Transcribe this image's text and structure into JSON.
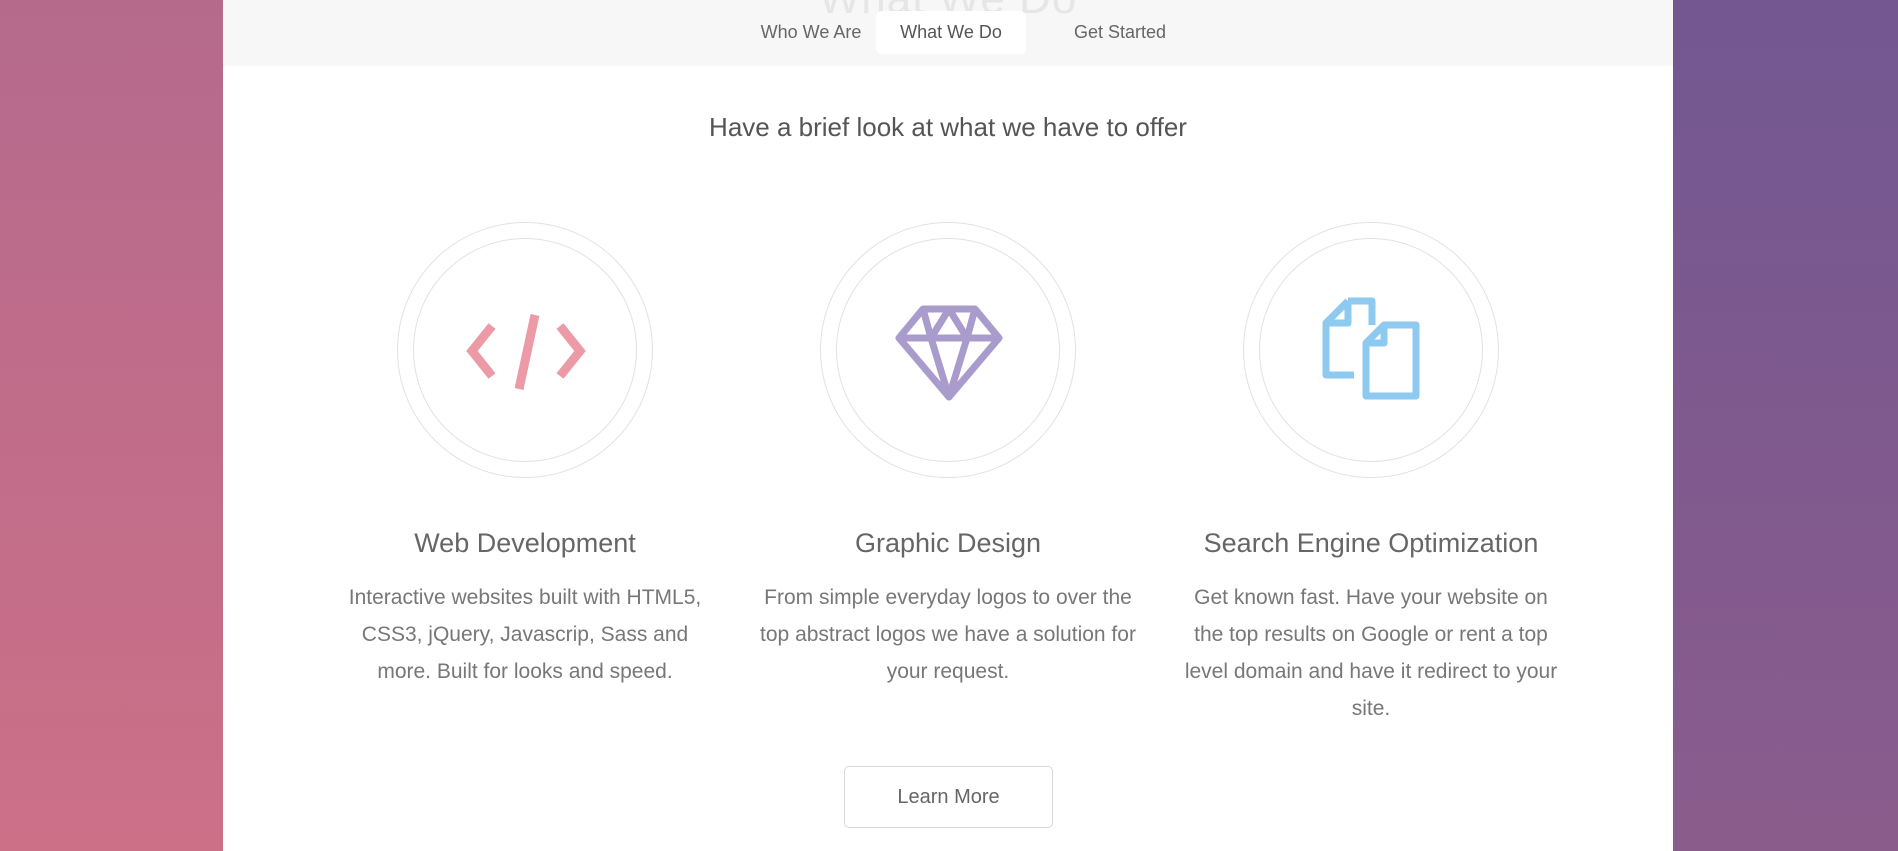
{
  "nav": {
    "ghost_title": "What We Do",
    "tabs": [
      {
        "label": "Who We Are"
      },
      {
        "label": "What We Do"
      },
      {
        "label": "Get Started"
      }
    ],
    "active_tab": "What We Do"
  },
  "main": {
    "subtitle": "Have a brief look at what we have to offer",
    "services": [
      {
        "icon": "code-icon",
        "icon_color": "#ec9aa6",
        "title": "Web Development",
        "description": "Interactive websites built with HTML5, CSS3, jQuery, Javascrip, Sass and more. Built for looks and speed."
      },
      {
        "icon": "diamond-icon",
        "icon_color": "#a99bcb",
        "title": "Graphic Design",
        "description": "From simple everyday logos to over the top abstract logos we have a solution for your request."
      },
      {
        "icon": "documents-icon",
        "icon_color": "#8ec9ef",
        "title": "Search Engine Optimization",
        "description": "Get known fast. Have your website on the top results on Google or rent a top level domain and have it redirect to your site."
      }
    ],
    "learn_more_label": "Learn More"
  }
}
